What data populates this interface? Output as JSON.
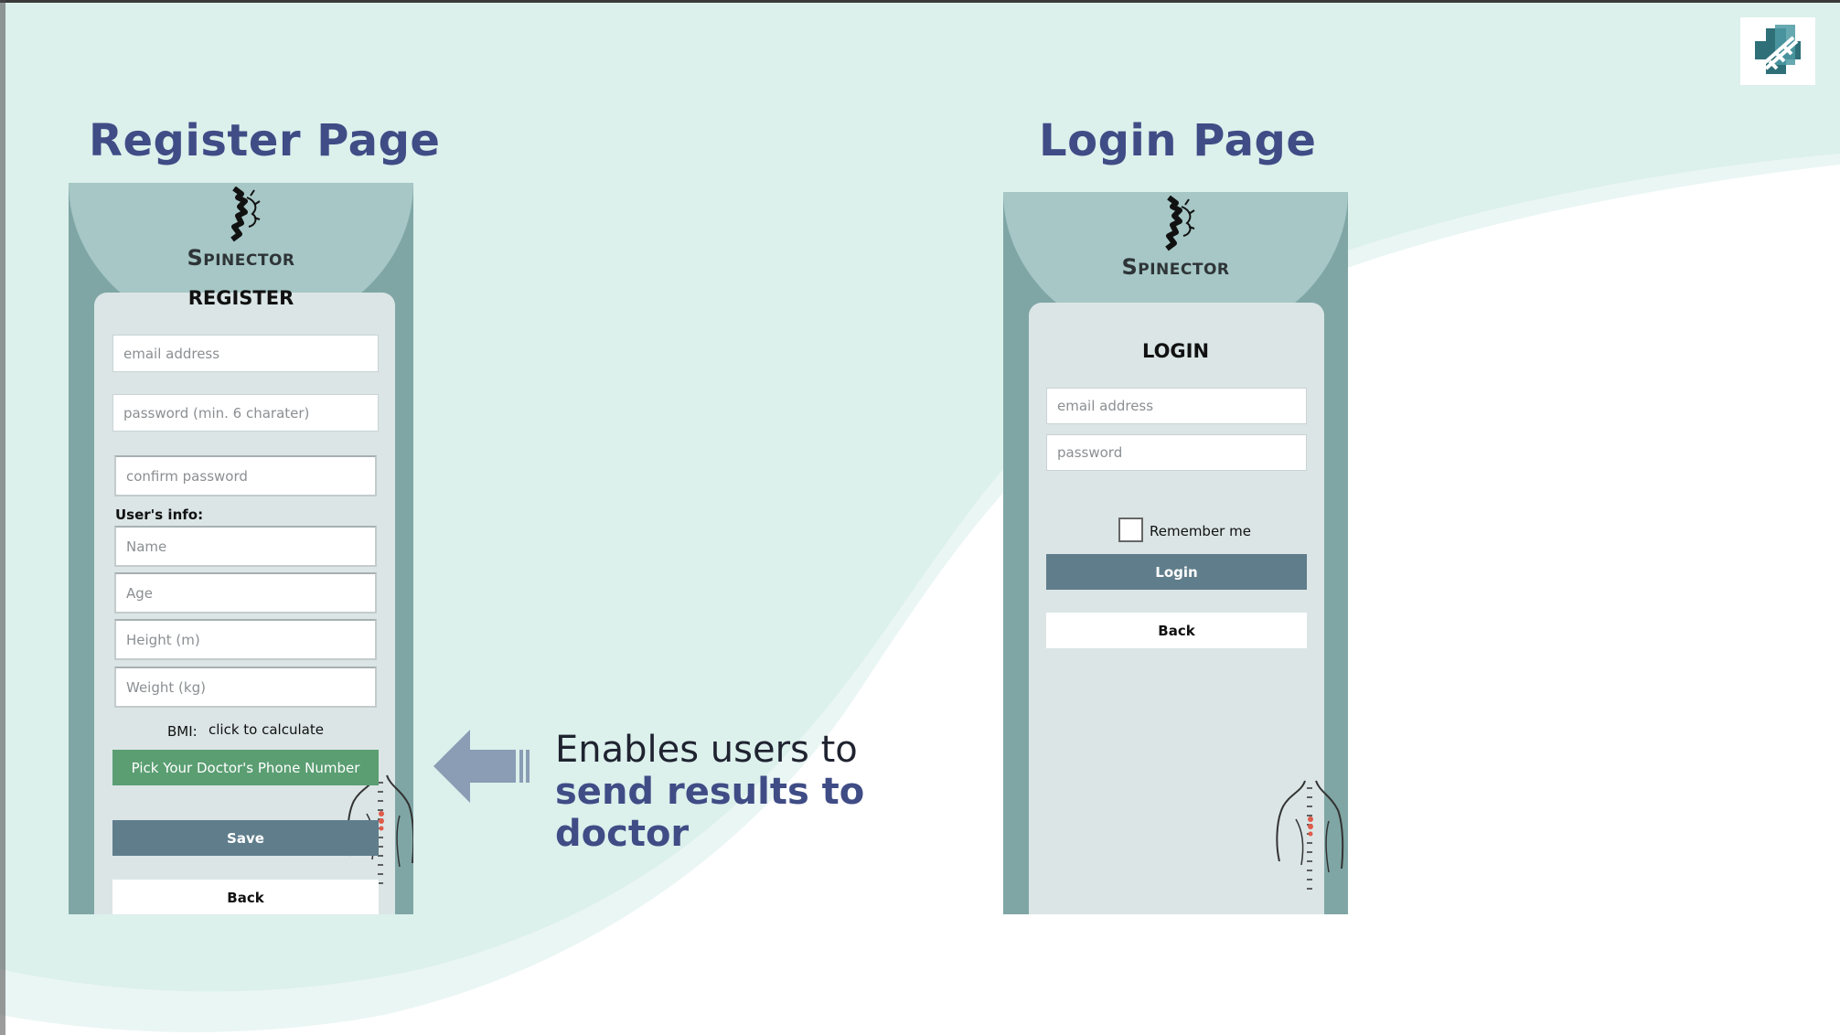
{
  "slide": {
    "register_heading": "Register Page",
    "login_heading": "Login Page",
    "caption_lead": "Enables users to",
    "caption_emphasis": "send results to doctor",
    "colors": {
      "heading": "#3f4c85",
      "background_wave": "#dcf0ec",
      "phone_frame": "#7fa6a5",
      "card": "#dbe5e6",
      "primary_button": "#607d8b",
      "doctor_button": "#5a9e72",
      "arrow": "#8a9db5"
    },
    "icons": [
      "medical-cross-logo-icon",
      "spinector-logo-icon",
      "torso-spine-icon",
      "left-arrow-icon"
    ]
  },
  "register": {
    "brand": "Spinector",
    "title": "REGISTER",
    "email_placeholder": "email address",
    "password_placeholder": "password (min. 6 charater)",
    "confirm_placeholder": "confirm password",
    "users_info_label": "User's info:",
    "name_placeholder": "Name",
    "age_placeholder": "Age",
    "height_placeholder": "Height (m)",
    "weight_placeholder": "Weight (kg)",
    "bmi_label": "BMI:",
    "bmi_action": "click to calculate",
    "doctor_button": "Pick Your Doctor's Phone Number",
    "save_button": "Save",
    "back_button": "Back"
  },
  "login": {
    "brand": "Spinector",
    "title": "LOGIN",
    "email_placeholder": "email address",
    "password_placeholder": "password",
    "remember_label": "Remember me",
    "login_button": "Login",
    "back_button": "Back"
  }
}
